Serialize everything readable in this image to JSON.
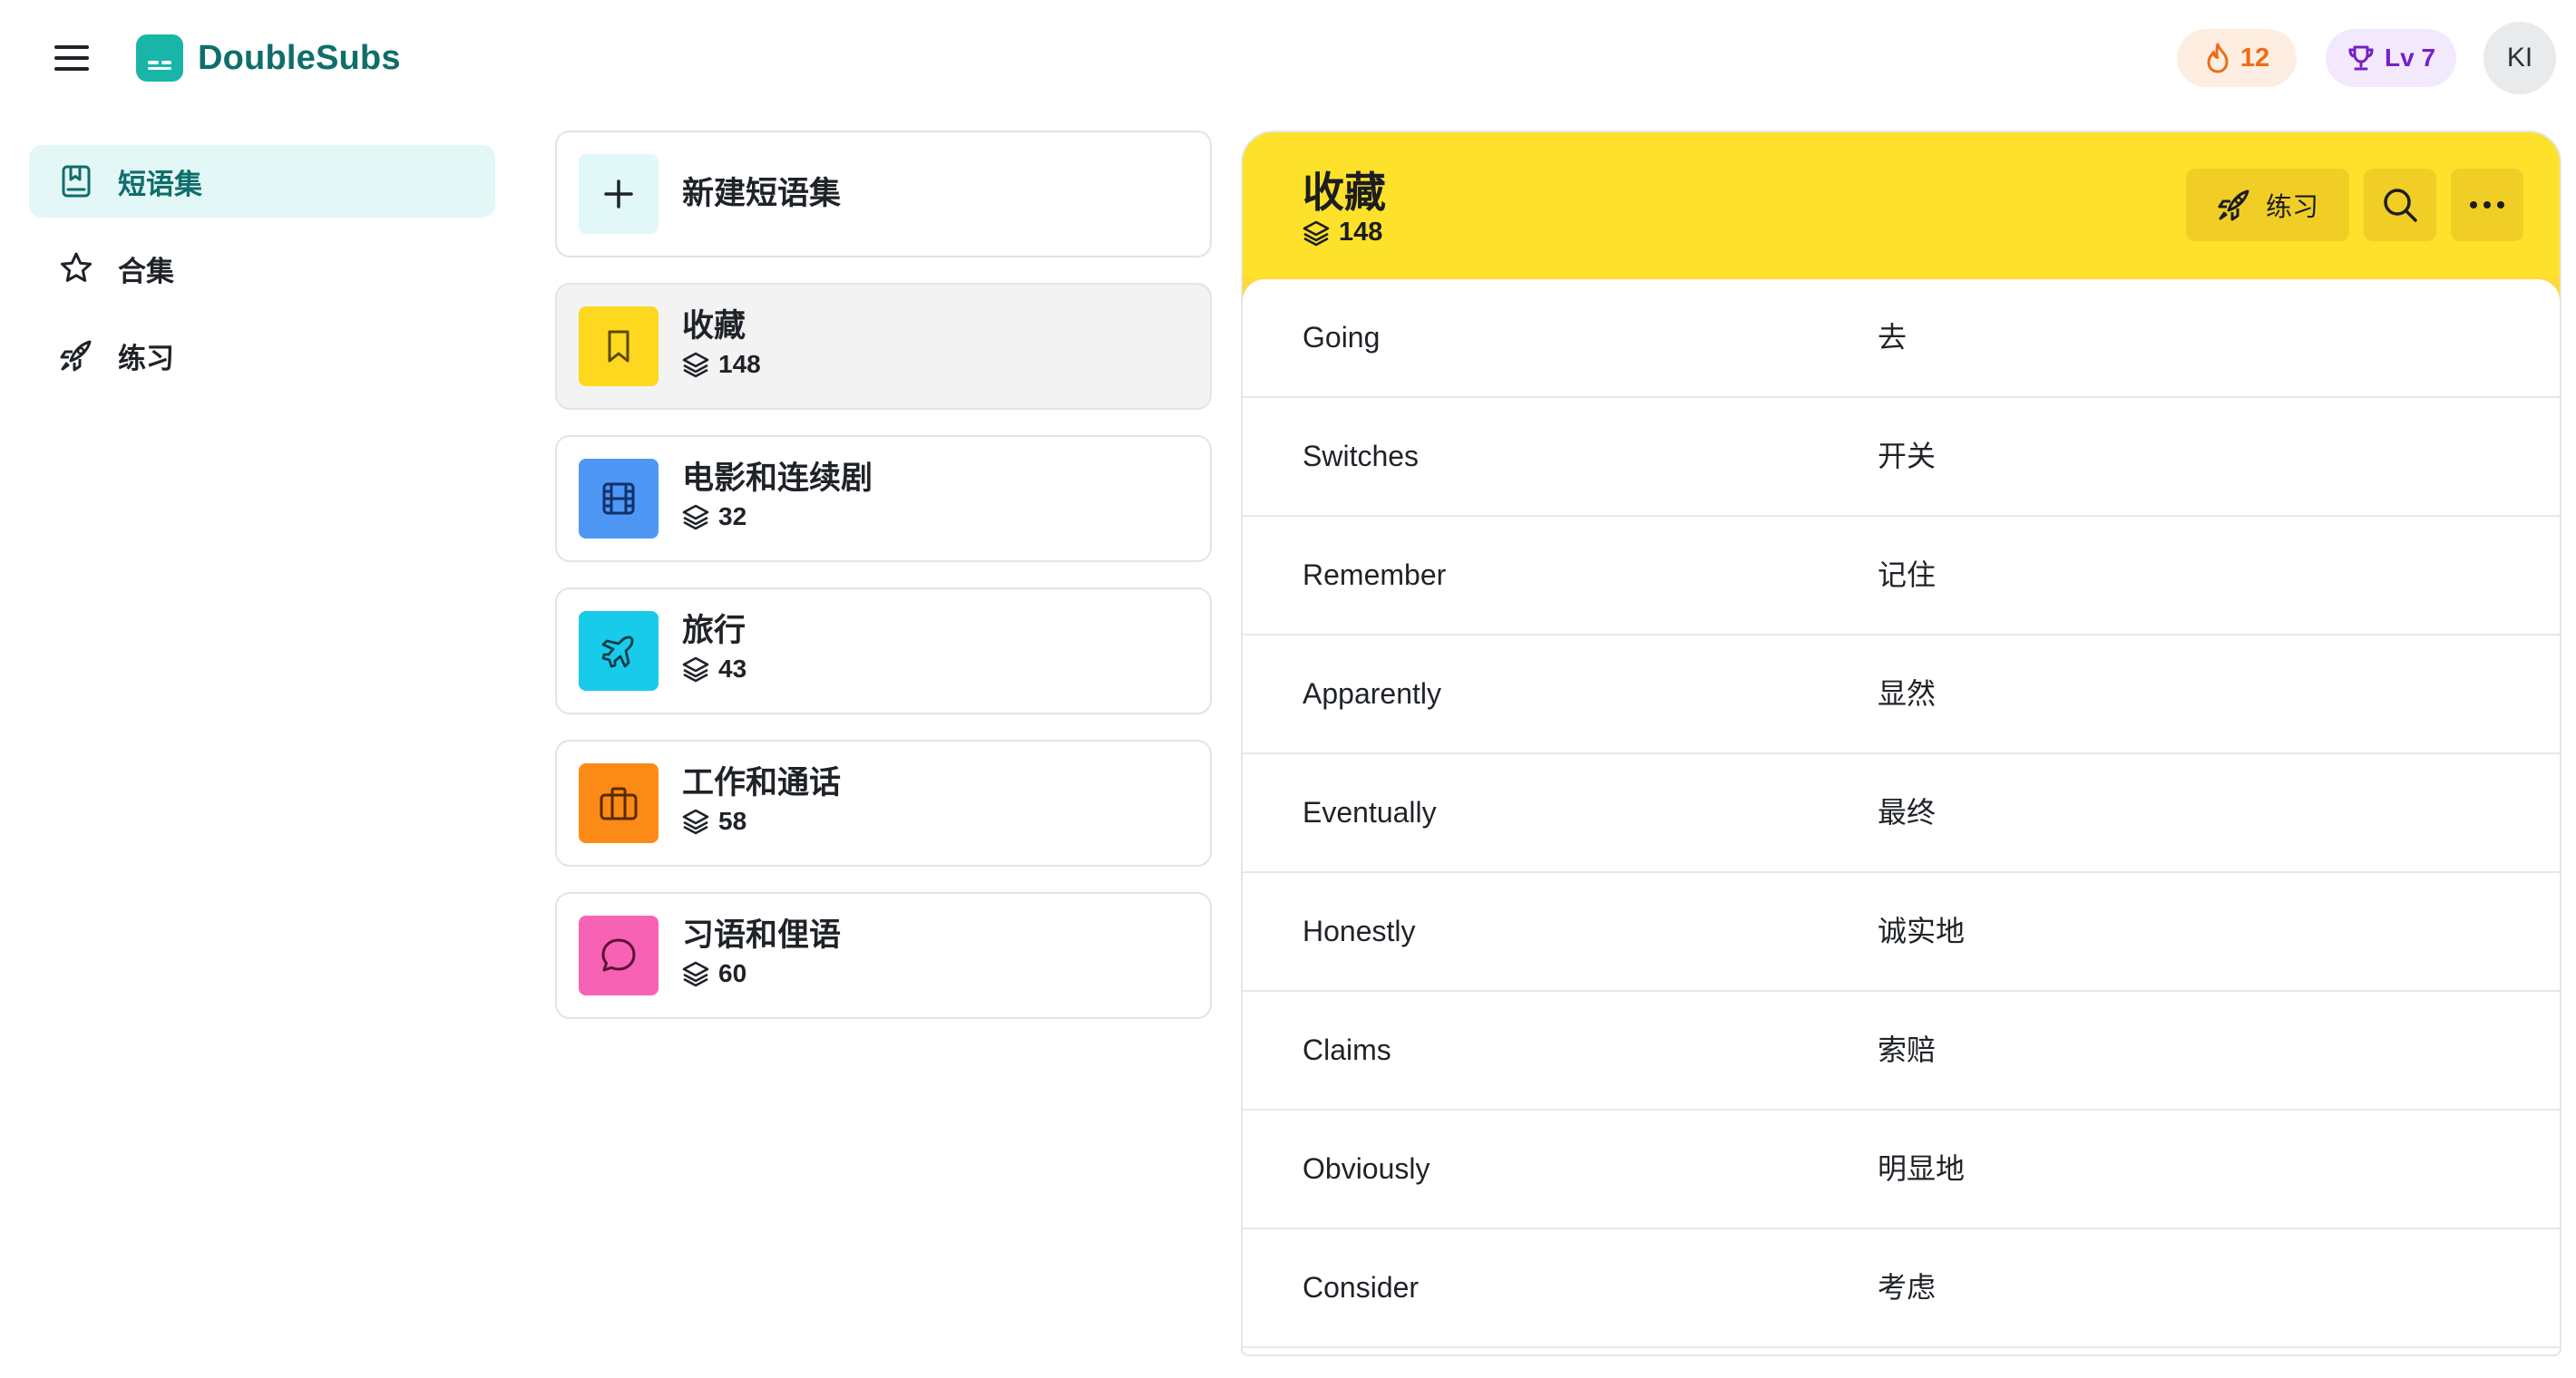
{
  "app": {
    "name": "DoubleSubs",
    "streak": "12",
    "level": "Lv 7",
    "avatar_initials": "KI",
    "accent": "#19b5a9"
  },
  "sidebar": {
    "items": [
      {
        "label": "短语集",
        "icon": "bookmark-book-icon",
        "active": true
      },
      {
        "label": "合集",
        "icon": "star-icon",
        "active": false
      },
      {
        "label": "练习",
        "icon": "rocket-icon",
        "active": false
      }
    ]
  },
  "collections": {
    "new_label": "新建短语集",
    "items": [
      {
        "title": "收藏",
        "count": "148",
        "icon": "bookmark-icon",
        "color": "#fdd81f",
        "selected": true
      },
      {
        "title": "电影和连续剧",
        "count": "32",
        "icon": "film-icon",
        "color": "#4f97f5"
      },
      {
        "title": "旅行",
        "count": "43",
        "icon": "airplane-icon",
        "color": "#19cbea"
      },
      {
        "title": "工作和通话",
        "count": "58",
        "icon": "briefcase-icon",
        "color": "#fb8b16"
      },
      {
        "title": "习语和俚语",
        "count": "60",
        "icon": "chat-bubble-icon",
        "color": "#f862b4"
      }
    ]
  },
  "detail": {
    "title": "收藏",
    "count": "148",
    "practice_label": "练习",
    "header_color": "#fee12a",
    "rows": [
      {
        "en": "Going",
        "zh": "去"
      },
      {
        "en": "Switches",
        "zh": "开关"
      },
      {
        "en": "Remember",
        "zh": "记住"
      },
      {
        "en": "Apparently",
        "zh": "显然"
      },
      {
        "en": "Eventually",
        "zh": "最终"
      },
      {
        "en": "Honestly",
        "zh": "诚实地"
      },
      {
        "en": "Claims",
        "zh": "索赔"
      },
      {
        "en": "Obviously",
        "zh": "明显地"
      },
      {
        "en": "Consider",
        "zh": "考虑"
      }
    ]
  }
}
